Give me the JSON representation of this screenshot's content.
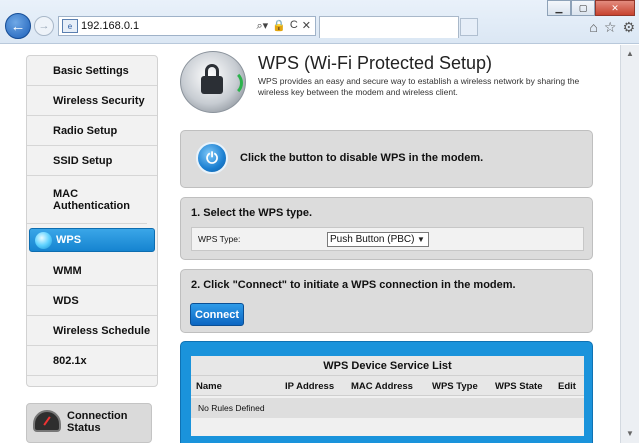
{
  "browser": {
    "address": "192.168.0.1",
    "address_tools": [
      "⌕▾",
      "🔒",
      "C",
      "✕"
    ],
    "window_controls": {
      "minimize": "▁",
      "maximize": "▢",
      "close": "✕"
    },
    "tools": [
      "⌂",
      "☆",
      "⚙"
    ]
  },
  "sidebar": {
    "items": [
      {
        "label": "Basic Settings"
      },
      {
        "label": "Wireless Security"
      },
      {
        "label": "Radio Setup"
      },
      {
        "label": "SSID Setup"
      },
      {
        "label": "MAC Authentication"
      },
      {
        "label": "WPS",
        "active": true
      },
      {
        "label": "WMM"
      },
      {
        "label": "WDS"
      },
      {
        "label": "Wireless Schedule"
      },
      {
        "label": "802.1x"
      }
    ],
    "connection_status": "Connection Status"
  },
  "header": {
    "title": "WPS (Wi-Fi Protected Setup)",
    "description": "WPS provides an easy and secure way to establish a wireless network by sharing the wireless key between the modem and wireless client."
  },
  "disable_panel": {
    "message": "Click the button to disable WPS in the modem."
  },
  "type_panel": {
    "heading": "1. Select the WPS type.",
    "label": "WPS Type:",
    "selected": "Push Button (PBC)"
  },
  "connect_panel": {
    "heading": "2. Click \"Connect\" to initiate a WPS connection in the modem.",
    "button": "Connect"
  },
  "device_list": {
    "title": "WPS Device Service List",
    "columns": [
      "Name",
      "IP Address",
      "MAC Address",
      "WPS Type",
      "WPS State",
      "Edit"
    ],
    "empty_text": "No Rules Defined"
  },
  "colors": {
    "accent": "#1a93db",
    "panel": "#dcdcdc",
    "active_nav": "#1684d0"
  }
}
